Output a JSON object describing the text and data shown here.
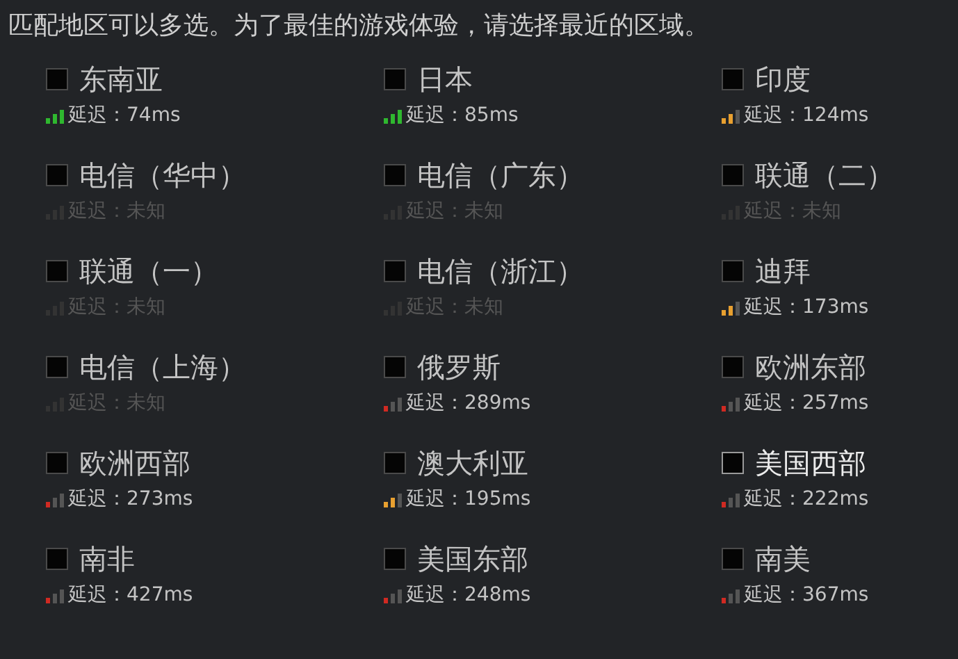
{
  "header": "匹配地区可以多选。为了最佳的游戏体验，请选择最近的区域。",
  "regions": [
    {
      "name": "东南亚",
      "checked": false,
      "highlighted": false,
      "disabled": false,
      "kind": "good",
      "color": "#2fb82f",
      "latency": "延迟：74ms"
    },
    {
      "name": "日本",
      "checked": false,
      "highlighted": false,
      "disabled": false,
      "kind": "good",
      "color": "#2fb82f",
      "latency": "延迟：85ms"
    },
    {
      "name": "印度",
      "checked": false,
      "highlighted": false,
      "disabled": false,
      "kind": "medium",
      "color": "#e8a030",
      "latency": "延迟：124ms"
    },
    {
      "name": "电信（华中）",
      "checked": false,
      "highlighted": false,
      "disabled": true,
      "kind": "unknown",
      "latency": "延迟：未知"
    },
    {
      "name": "电信（广东）",
      "checked": false,
      "highlighted": false,
      "disabled": true,
      "kind": "unknown",
      "latency": "延迟：未知"
    },
    {
      "name": "联通（二）",
      "checked": false,
      "highlighted": false,
      "disabled": true,
      "kind": "unknown",
      "latency": "延迟：未知"
    },
    {
      "name": "联通（一）",
      "checked": false,
      "highlighted": false,
      "disabled": true,
      "kind": "unknown",
      "latency": "延迟：未知"
    },
    {
      "name": "电信（浙江）",
      "checked": false,
      "highlighted": false,
      "disabled": true,
      "kind": "unknown",
      "latency": "延迟：未知"
    },
    {
      "name": "迪拜",
      "checked": false,
      "highlighted": false,
      "disabled": false,
      "kind": "medium",
      "color": "#e8a030",
      "latency": "延迟：173ms"
    },
    {
      "name": "电信（上海）",
      "checked": false,
      "highlighted": false,
      "disabled": true,
      "kind": "unknown",
      "latency": "延迟：未知"
    },
    {
      "name": "俄罗斯",
      "checked": false,
      "highlighted": false,
      "disabled": false,
      "kind": "poor",
      "color": "#d02a22",
      "latency": "延迟：289ms"
    },
    {
      "name": "欧洲东部",
      "checked": false,
      "highlighted": false,
      "disabled": false,
      "kind": "poor",
      "color": "#d02a22",
      "latency": "延迟：257ms"
    },
    {
      "name": "欧洲西部",
      "checked": false,
      "highlighted": false,
      "disabled": false,
      "kind": "poor",
      "color": "#d02a22",
      "latency": "延迟：273ms"
    },
    {
      "name": "澳大利亚",
      "checked": false,
      "highlighted": false,
      "disabled": false,
      "kind": "medium",
      "color": "#e8a030",
      "latency": "延迟：195ms"
    },
    {
      "name": "美国西部",
      "checked": false,
      "highlighted": true,
      "disabled": false,
      "kind": "poor",
      "color": "#d02a22",
      "latency": "延迟：222ms"
    },
    {
      "name": "南非",
      "checked": false,
      "highlighted": false,
      "disabled": false,
      "kind": "poor",
      "color": "#d02a22",
      "latency": "延迟：427ms"
    },
    {
      "name": "美国东部",
      "checked": false,
      "highlighted": false,
      "disabled": false,
      "kind": "poor",
      "color": "#d02a22",
      "latency": "延迟：248ms"
    },
    {
      "name": "南美",
      "checked": false,
      "highlighted": false,
      "disabled": false,
      "kind": "poor",
      "color": "#d02a22",
      "latency": "延迟：367ms"
    }
  ]
}
